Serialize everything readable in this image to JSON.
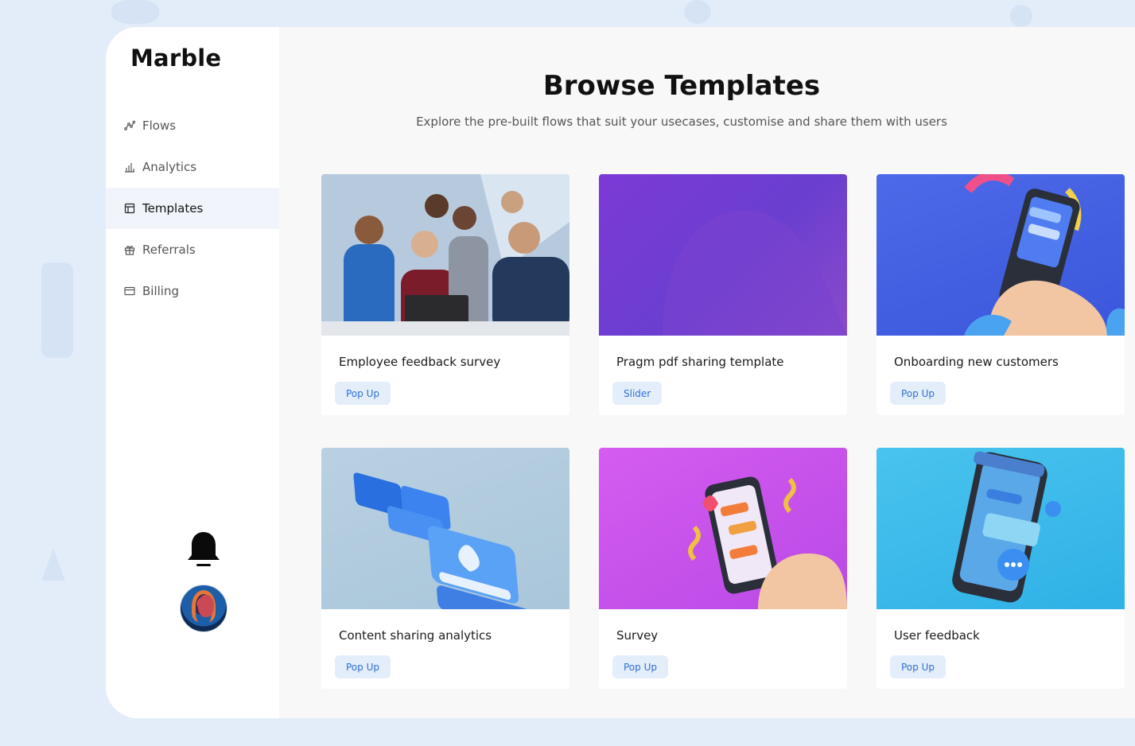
{
  "app": {
    "logo": "Marble"
  },
  "sidebar": {
    "items": [
      {
        "label": "Flows",
        "icon": "flows-icon",
        "active": false
      },
      {
        "label": "Analytics",
        "icon": "analytics-icon",
        "active": false
      },
      {
        "label": "Templates",
        "icon": "templates-icon",
        "active": true
      },
      {
        "label": "Referrals",
        "icon": "gift-icon",
        "active": false
      },
      {
        "label": "Billing",
        "icon": "card-icon",
        "active": false
      }
    ],
    "footer": {
      "bell_icon": "bell-icon",
      "avatar": "user-avatar"
    }
  },
  "main": {
    "title": "Browse Templates",
    "subtitle": "Explore the pre-built flows that suit your usecases, customise and share them with users",
    "cards": [
      {
        "title": "Employee feedback survey",
        "tag": "Pop Up"
      },
      {
        "title": "Pragm pdf sharing template",
        "tag": "Slider"
      },
      {
        "title": "Onboarding new customers",
        "tag": "Pop Up"
      },
      {
        "title": "Content sharing analytics",
        "tag": "Pop Up"
      },
      {
        "title": "Survey",
        "tag": "Pop Up"
      },
      {
        "title": "User feedback",
        "tag": "Pop Up"
      }
    ]
  },
  "colors": {
    "background": "#e3edfa",
    "panel": "#f8f8f8",
    "tag_bg": "#e4eefb",
    "tag_text": "#2f6fd6",
    "active_nav": "#f1f5fb"
  }
}
